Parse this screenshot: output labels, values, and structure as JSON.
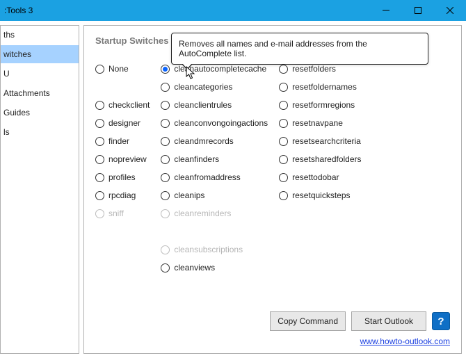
{
  "window": {
    "title": ":Tools 3"
  },
  "sidebar": {
    "items": [
      {
        "label": "ths",
        "selected": false
      },
      {
        "label": "witches",
        "selected": true
      },
      {
        "label": "U",
        "selected": false
      },
      {
        "label": "Attachments",
        "selected": false
      },
      {
        "label": "Guides",
        "selected": false
      },
      {
        "label": "ls",
        "selected": false
      }
    ]
  },
  "panel": {
    "heading": "Startup Switches",
    "tooltip": "Removes all names and e-mail addresses from the AutoComplete list.",
    "selected": "cleanautocompletecache",
    "columns": [
      [
        {
          "value": "None",
          "disabled": false
        },
        {
          "value": "",
          "disabled": false,
          "blank": true
        },
        {
          "value": "checkclient",
          "disabled": false
        },
        {
          "value": "designer",
          "disabled": false
        },
        {
          "value": "finder",
          "disabled": false
        },
        {
          "value": "nopreview",
          "disabled": false
        },
        {
          "value": "profiles",
          "disabled": false
        },
        {
          "value": "rpcdiag",
          "disabled": false
        },
        {
          "value": "sniff",
          "disabled": true
        }
      ],
      [
        {
          "value": "cleanautocompletecache",
          "disabled": false
        },
        {
          "value": "cleancategories",
          "disabled": false
        },
        {
          "value": "cleanclientrules",
          "disabled": false
        },
        {
          "value": "cleanconvongoingactions",
          "disabled": false
        },
        {
          "value": "cleandmrecords",
          "disabled": false
        },
        {
          "value": "cleanfinders",
          "disabled": false
        },
        {
          "value": "cleanfromaddress",
          "disabled": false
        },
        {
          "value": "cleanips",
          "disabled": false
        },
        {
          "value": "cleanreminders",
          "disabled": true
        },
        {
          "value": "",
          "disabled": false,
          "blank": true
        },
        {
          "value": "cleansubscriptions",
          "disabled": true
        },
        {
          "value": "cleanviews",
          "disabled": false
        }
      ],
      [
        {
          "value": "resetfolders",
          "disabled": false
        },
        {
          "value": "resetfoldernames",
          "disabled": false
        },
        {
          "value": "resetformregions",
          "disabled": false
        },
        {
          "value": "resetnavpane",
          "disabled": false
        },
        {
          "value": "resetsearchcriteria",
          "disabled": false
        },
        {
          "value": "resetsharedfolders",
          "disabled": false
        },
        {
          "value": "resettodobar",
          "disabled": false
        },
        {
          "value": "resetquicksteps",
          "disabled": false
        }
      ]
    ],
    "buttons": {
      "copy": "Copy Command",
      "start": "Start Outlook"
    },
    "link": "www.howto-outlook.com"
  }
}
